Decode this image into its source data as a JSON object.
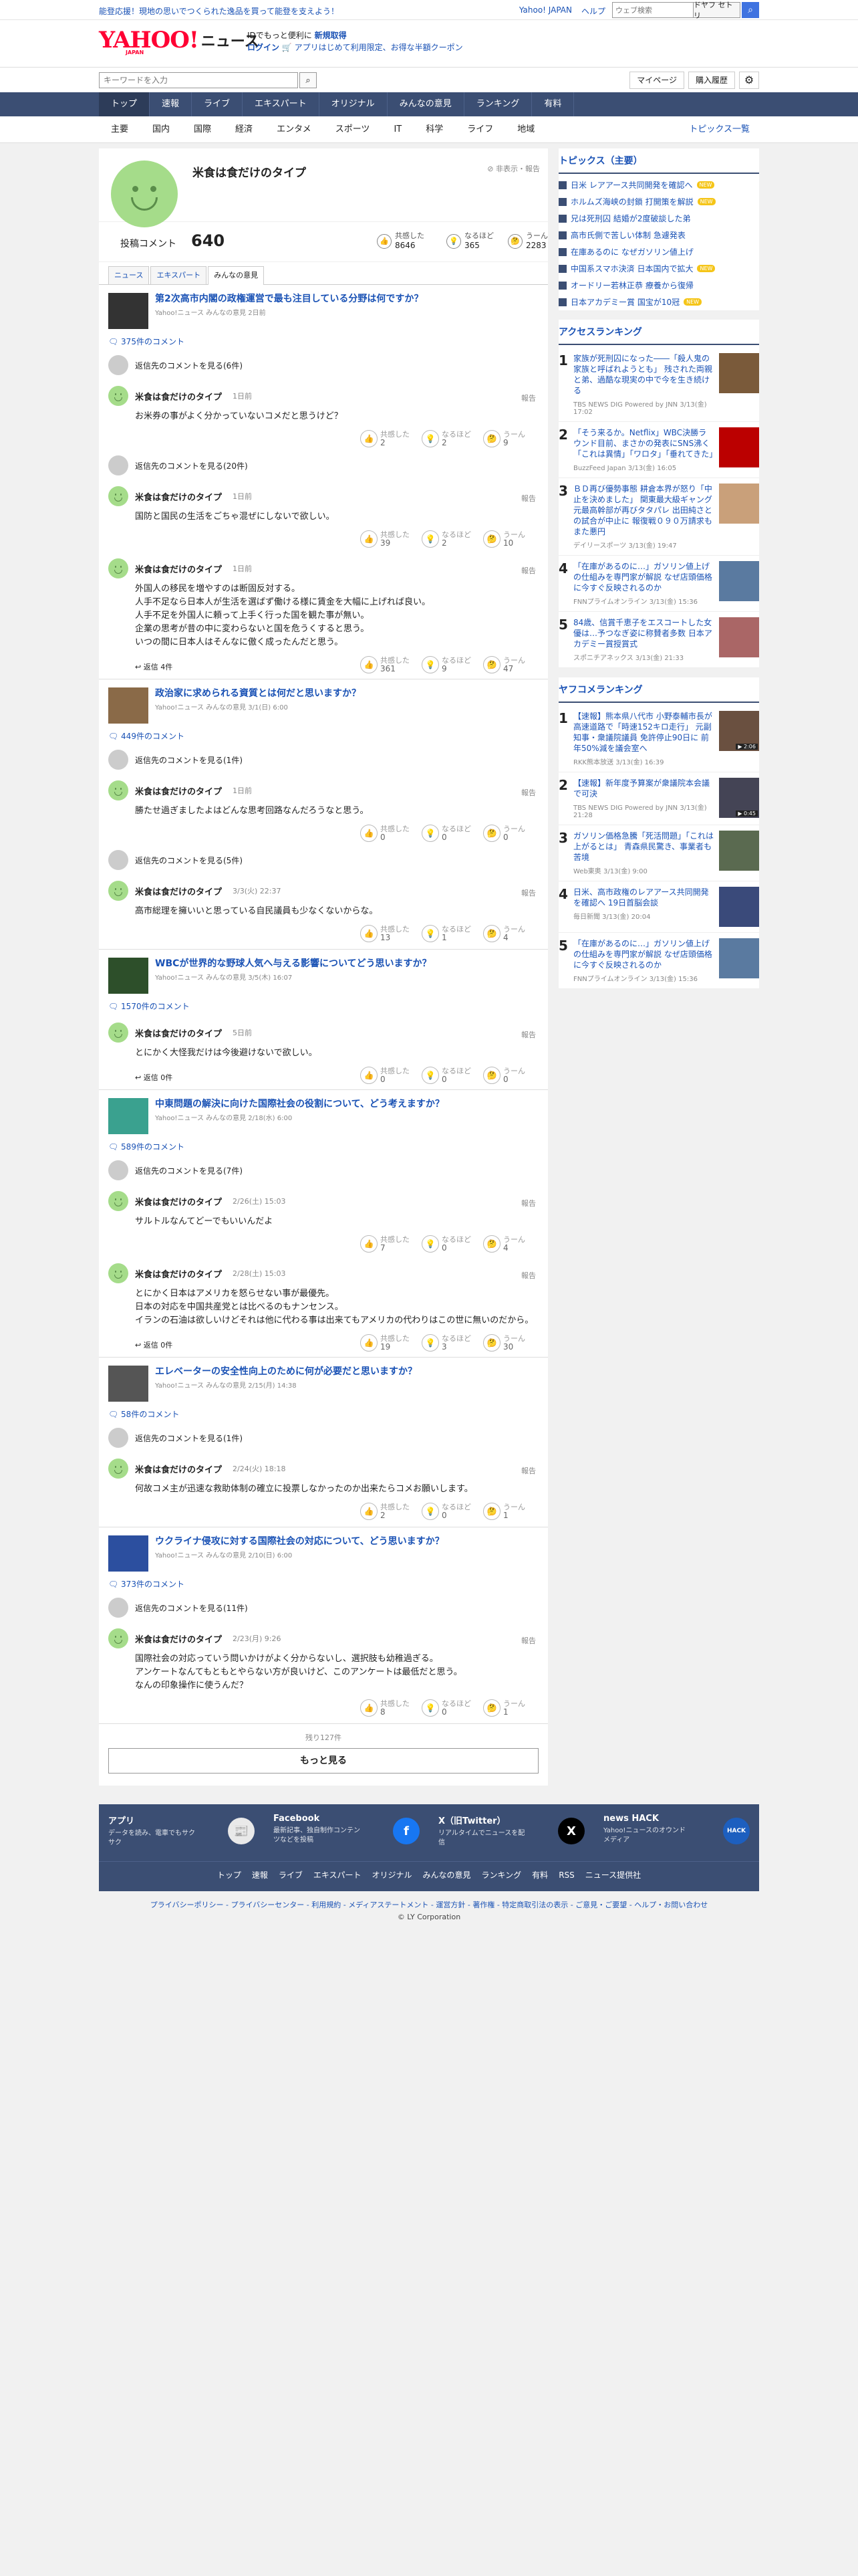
{
  "top": {
    "promo": "能登応援！現地の思いでつくられた逸品を買って能登を支えよう！",
    "links": [
      "Yahoo! JAPAN",
      "ヘルプ"
    ],
    "search_placeholder": "ウェブ検索",
    "search_label": "ドヤフ セトリ"
  },
  "header": {
    "logo": "YAHOO!",
    "logo_sub": "JAPAN",
    "logo_news": "ニュース",
    "line1_pre": "IDでもっと便利に",
    "line1_link": "新規取得",
    "line2_login": "ログイン",
    "line2_text": "🛒 アプリはじめて利用限定、お得な半額クーポン"
  },
  "subsearch": {
    "placeholder": "キーワードを入力",
    "mypage": "マイページ",
    "history": "購入履歴"
  },
  "gnav": [
    "トップ",
    "速報",
    "ライブ",
    "エキスパート",
    "オリジナル",
    "みんなの意見",
    "ランキング",
    "有料"
  ],
  "snav": [
    "主要",
    "国内",
    "国際",
    "経済",
    "エンタメ",
    "スポーツ",
    "IT",
    "科学",
    "ライフ",
    "地域"
  ],
  "snav_topics": "トピックス一覧",
  "profile": {
    "name": "米食は食だけのタイプ",
    "hide_report": "非表示・報告",
    "post_label": "投稿コメント",
    "post_count": "640",
    "reactions": [
      {
        "label": "共感した",
        "value": "8646",
        "icon": "👍"
      },
      {
        "label": "なるほど",
        "value": "365",
        "icon": "💡"
      },
      {
        "label": "うーん",
        "value": "2283",
        "icon": "🤔"
      }
    ],
    "tabs": [
      "ニュース",
      "エキスパート",
      "みんなの意見"
    ]
  },
  "articles": [
    {
      "title": "第2次高市内閣の政権運営で最も注目している分野は何ですか？",
      "source": "Yahoo!ニュース みんなの意見 2日前",
      "count": "375件のコメント",
      "thumb_color": "#333",
      "toggles": [
        "返信先のコメントを見る(6件)",
        "返信先のコメントを見る(20件)"
      ],
      "comments": [
        {
          "name": "米食は食だけのタイプ",
          "date": "1日前",
          "text": "お米券の事がよく分かっていないコメだと思うけど？",
          "r": [
            "2",
            "2",
            "9"
          ],
          "replies": ""
        },
        {
          "name": "米食は食だけのタイプ",
          "date": "1日前",
          "text": "国防と国民の生活をごちゃ混ぜにしないで欲しい。",
          "r": [
            "39",
            "2",
            "10"
          ],
          "replies": ""
        },
        {
          "name": "米食は食だけのタイプ",
          "date": "1日前",
          "text": "外国人の移民を増やすのは断固反対する。\n人手不足なら日本人が生活を選ばず働ける様に賃金を大幅に上げれば良い。\n人手不足を外国人に頼って上手く行った国を観た事が無い。\n企業の思考が昔の中に変わらないと国を危うくすると思う。\nいつの間に日本人はそんなに傲く成ったんだと思う。",
          "r": [
            "361",
            "9",
            "47"
          ],
          "replies": "返信 4件"
        }
      ]
    },
    {
      "title": "政治家に求められる資質とは何だと思いますか？",
      "source": "Yahoo!ニュース みんなの意見 3/1(日) 6:00",
      "count": "449件のコメント",
      "thumb_color": "#8a6a48",
      "toggles": [
        "返信先のコメントを見る(1件)",
        "返信先のコメントを見る(5件)"
      ],
      "comments": [
        {
          "name": "米食は食だけのタイプ",
          "date": "1日前",
          "text": "勝たせ過ぎましたよはどんな思考回路なんだろうなと思う。",
          "r": [
            "0",
            "0",
            "0"
          ],
          "replies": ""
        },
        {
          "name": "米食は食だけのタイプ",
          "date": "3/3(火) 22:37",
          "text": "高市総理を擁いいと思っている自民議員も少なくないからな。",
          "r": [
            "13",
            "1",
            "4"
          ],
          "replies": ""
        }
      ]
    },
    {
      "title": "WBCが世界的な野球人気へ与える影響についてどう思いますか？",
      "source": "Yahoo!ニュース みんなの意見 3/5(木) 16:07",
      "count": "1570件のコメント",
      "thumb_color": "#2d4f2a",
      "toggles": [],
      "comments": [
        {
          "name": "米食は食だけのタイプ",
          "date": "5日前",
          "text": "とにかく大怪我だけは今後避けないで欲しい。",
          "r": [
            "0",
            "0",
            "0"
          ],
          "replies": "返信 0件"
        }
      ]
    },
    {
      "title": "中東問題の解決に向けた国際社会の役割について、どう考えますか？",
      "source": "Yahoo!ニュース みんなの意見 2/18(水) 6:00",
      "count": "589件のコメント",
      "thumb_color": "#3aa18f",
      "toggles": [
        "返信先のコメントを見る(7件)"
      ],
      "comments": [
        {
          "name": "米食は食だけのタイプ",
          "date": "2/26(土) 15:03",
          "text": "サルトルなんてどーでもいいんだよ",
          "r": [
            "7",
            "0",
            "4"
          ],
          "replies": ""
        },
        {
          "name": "米食は食だけのタイプ",
          "date": "2/28(土) 15:03",
          "text": "とにかく日本はアメリカを怒らせない事が最優先。\n日本の対応を中国共産党とは比べるのもナンセンス。\nイランの石油は欲しいけどそれは他に代わる事は出来てもアメリカの代わりはこの世に無いのだから。",
          "r": [
            "19",
            "3",
            "30"
          ],
          "replies": "返信 0件"
        }
      ]
    },
    {
      "title": "エレベーターの安全性向上のために何が必要だと思いますか？",
      "source": "Yahoo!ニュース みんなの意見 2/15(月) 14:38",
      "count": "58件のコメント",
      "thumb_color": "#555",
      "toggles": [
        "返信先のコメントを見る(1件)"
      ],
      "comments": [
        {
          "name": "米食は食だけのタイプ",
          "date": "2/24(火) 18:18",
          "text": "何故コメ主が迅速な救助体制の確立に投票しなかったのか出来たらコメお願いします。",
          "r": [
            "2",
            "0",
            "1"
          ],
          "replies": ""
        }
      ]
    },
    {
      "title": "ウクライナ侵攻に対する国際社会の対応について、どう思いますか？",
      "source": "Yahoo!ニュース みんなの意見 2/10(日) 6:00",
      "count": "373件のコメント",
      "thumb_color": "#2c4f9f",
      "toggles": [
        "返信先のコメントを見る(11件)"
      ],
      "comments": [
        {
          "name": "米食は食だけのタイプ",
          "date": "2/23(月) 9:26",
          "text": "国際社会の対応っていう問いかけがよく分からないし、選択肢も幼稚過ぎる。\nアンケートなんてもともとやらない方が良いけど、このアンケートは最低だと思う。\nなんの印象操作に使うんだ？",
          "r": [
            "8",
            "0",
            "1"
          ],
          "replies": ""
        }
      ]
    }
  ],
  "more": {
    "remain": "残り127件",
    "button": "もっと見る"
  },
  "topics": {
    "title": "トピックス（主要）",
    "items": [
      {
        "text": "日米 レアアース共同開発を確認へ",
        "badge": "NEW"
      },
      {
        "text": "ホルムズ海峡の封鎖 打開策を解説",
        "badge": "NEW"
      },
      {
        "text": "兄は死刑囚 結婚が2度破談した弟",
        "badge": ""
      },
      {
        "text": "高市氏側で苦しい体制 急遽発表",
        "badge": ""
      },
      {
        "text": "在庫あるのに なぜガソリン値上げ",
        "badge": ""
      },
      {
        "text": "中国系スマホ決済 日本国内で拡大",
        "badge": "NEW"
      },
      {
        "text": "オードリー若林正恭 療養から復帰",
        "badge": ""
      },
      {
        "text": "日本アカデミー賞 国宝が10冠",
        "badge": "NEW"
      }
    ]
  },
  "access_ranking": {
    "title": "アクセスランキング",
    "items": [
      {
        "n": "1",
        "text": "家族が死刑囚になった――「殺人鬼の家族と呼ばれようとも」 残された両親と弟、過酷な現実の中で今を生き続ける",
        "src": "TBS NEWS DIG Powered by JNN 3/13(金) 17:02",
        "color": "#7a5a3a"
      },
      {
        "n": "2",
        "text": "「そう来るか。Netflix」WBC決勝ラウンド目前、まさかの発表にSNS沸く「これは異情」「ワロタ」「垂れてきた」",
        "src": "BuzzFeed Japan 3/13(金) 16:05",
        "color": "#b00"
      },
      {
        "n": "3",
        "text": "ＢＤ再び優勢事態 耕倉本界が怒り「中止を決めました」 関東最大級ギャング元最高幹部が再びタタパレ 出田純さとの試合が中止に 報復戦０９０万請求もまた悪円",
        "src": "デイリースポーツ 3/13(金) 19:47",
        "color": "#c9a07a"
      },
      {
        "n": "4",
        "text": "「在庫があるのに…」ガソリン値上げの仕組みを専門家が解説 なぜ店頭価格に今すぐ反映されるのか",
        "src": "FNNプライムオンライン 3/13(金) 15:36",
        "color": "#5a7aa0"
      },
      {
        "n": "5",
        "text": "84歳、信賞千恵子をエスコートした女優は…予つなぎ姿に称賛者多数 日本アカデミー賞授賞式",
        "src": "スポニチアネックス 3/13(金) 21:33",
        "color": "#a66"
      }
    ]
  },
  "yahoo_ranking": {
    "title": "ヤフコメランキング",
    "items": [
      {
        "n": "1",
        "text": "【速報】熊本県八代市 小野泰輔市長が高速道路で「時速152キロ走行」 元副知事・衆議院議員 免許停止90日に 前年50%減を議会室へ",
        "src": "RKK熊本放送 3/13(金) 16:39",
        "color": "#6a5040",
        "badge": "2:06"
      },
      {
        "n": "2",
        "text": "【速報】新年度予算案が衆議院本会議で可決",
        "src": "TBS NEWS DIG Powered by JNN 3/13(金) 21:28",
        "color": "#445",
        "badge": "0:45"
      },
      {
        "n": "3",
        "text": "ガソリン価格急騰「死活問題」「これは上がるとは」 青森県民驚き、事業者も苦境",
        "src": "Web東奥 3/13(金) 9:00",
        "color": "#5a6a50",
        "badge": ""
      },
      {
        "n": "4",
        "text": "日米、高市政権のレアアース共同開発を確認へ 19日首脳会談",
        "src": "毎日新聞 3/13(金) 20:04",
        "color": "#3a4a7a",
        "badge": ""
      },
      {
        "n": "5",
        "text": "「在庫があるのに…」ガソリン値上げの仕組みを専門家が解説 なぜ店頭価格に今すぐ反映されるのか",
        "src": "FNNプライムオンライン 3/13(金) 15:36",
        "color": "#5a7aa0",
        "badge": ""
      }
    ]
  },
  "footer": {
    "items": [
      {
        "title": "アプリ",
        "desc": "データを読み、電車でもサクサク",
        "icon": "📰",
        "bg": "#e9e9e9"
      },
      {
        "title": "Facebook",
        "desc": "最新記事、独自制作コンテンツなどを投稿",
        "icon": "f",
        "bg": "#1877f2"
      },
      {
        "title": "X（旧Twitter）",
        "desc": "リアルタイムでニュースを配信",
        "icon": "X",
        "bg": "#000"
      },
      {
        "title": "news HACK",
        "desc": "Yahoo!ニュースのオウンドメディア",
        "icon": "HACK",
        "bg": "#1d5fbf"
      }
    ],
    "links": [
      "トップ",
      "速報",
      "ライブ",
      "エキスパート",
      "オリジナル",
      "みんなの意見",
      "ランキング",
      "有料",
      "RSS",
      "ニュース提供社"
    ],
    "bottom": "プライバシーポリシー - プライバシーセンター - 利用規約 - メディアステートメント - 運営方針 - 著作権 - 特定商取引法の表示 - ご意見・ご要望 - ヘルプ・お問い合わせ",
    "copyright": "© LY Corporation"
  }
}
